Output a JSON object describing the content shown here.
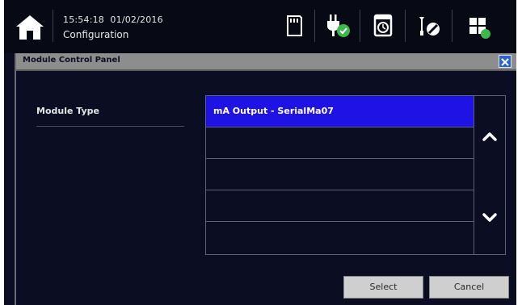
{
  "status_bar": {
    "time": "15:54:18",
    "date": "01/02/2016",
    "screen_title": "Configuration",
    "icons": [
      "home-icon",
      "sd-card-icon",
      "power-plug-check-icon",
      "alarm-clock-icon",
      "wrench-screwdriver-icon",
      "network-module-icon"
    ]
  },
  "dialog": {
    "title": "Module Control Panel",
    "field_label": "Module Type",
    "list_items": [
      "mA Output - SerialMa07",
      "",
      "",
      "",
      ""
    ],
    "selected_index": 0,
    "select_label": "Select",
    "cancel_label": "Cancel"
  },
  "colors": {
    "background": "#0b0e22",
    "selection": "#1e13e4",
    "title_bar": "#8d8d8d",
    "close_button": "#2a63c9",
    "status_ok": "#3db84a"
  }
}
